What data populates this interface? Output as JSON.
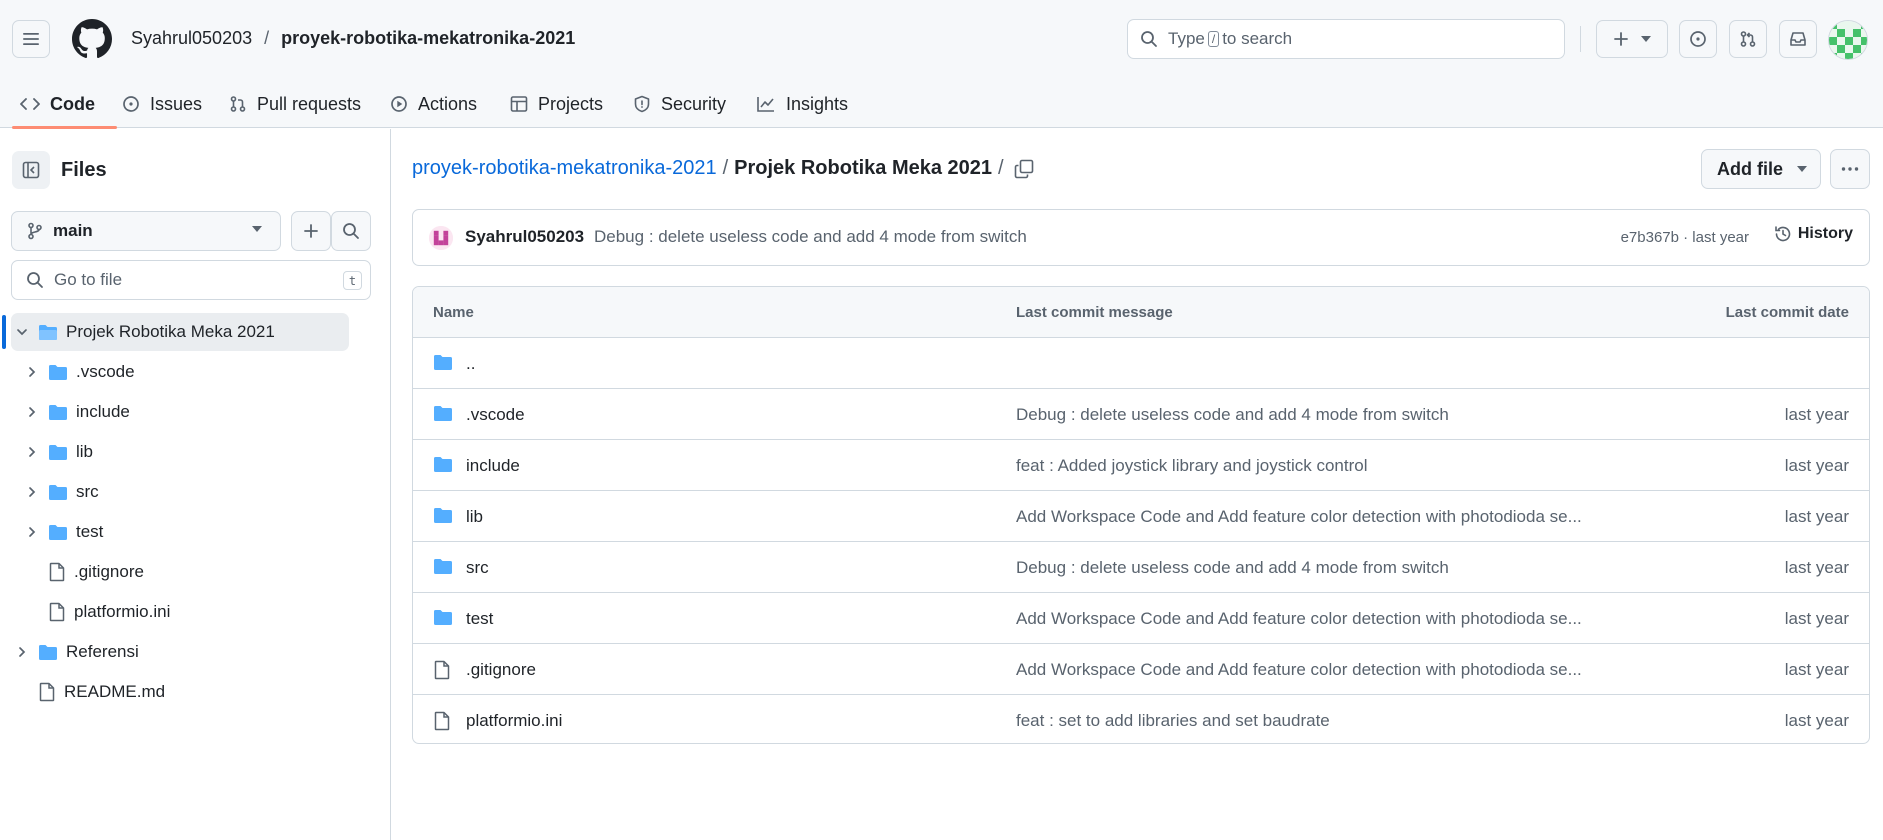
{
  "header": {
    "owner": "Syahrul050203",
    "separator": "/",
    "repo": "proyek-robotika-mekatronika-2021",
    "search_prefix": "Type",
    "search_key": "/",
    "search_suffix": "to search"
  },
  "tabs": [
    {
      "label": "Code",
      "icon": "code-icon",
      "active": true
    },
    {
      "label": "Issues",
      "icon": "issue-icon"
    },
    {
      "label": "Pull requests",
      "icon": "pull-request-icon"
    },
    {
      "label": "Actions",
      "icon": "play-icon"
    },
    {
      "label": "Projects",
      "icon": "table-icon"
    },
    {
      "label": "Security",
      "icon": "shield-icon"
    },
    {
      "label": "Insights",
      "icon": "graph-icon"
    }
  ],
  "sidebar": {
    "title": "Files",
    "branch": "main",
    "goto_placeholder": "Go to file",
    "goto_key": "t",
    "tree": [
      {
        "label": "Projek Robotika Meka 2021",
        "type": "folder",
        "expanded": true,
        "selected": true
      },
      {
        "label": ".vscode",
        "type": "folder"
      },
      {
        "label": "include",
        "type": "folder"
      },
      {
        "label": "lib",
        "type": "folder"
      },
      {
        "label": "src",
        "type": "folder"
      },
      {
        "label": "test",
        "type": "folder"
      },
      {
        "label": ".gitignore",
        "type": "file"
      },
      {
        "label": "platformio.ini",
        "type": "file"
      },
      {
        "label": "Referensi",
        "type": "folder"
      },
      {
        "label": "README.md",
        "type": "file"
      }
    ]
  },
  "main": {
    "path_repo": "proyek-robotika-mekatronika-2021",
    "path_sep": "/",
    "path_current": "Projek Robotika Meka 2021",
    "path_trailing": "/",
    "add_file_label": "Add file",
    "commit": {
      "author": "Syahrul050203",
      "message": "Debug : delete useless code and add 4 mode from switch",
      "meta": "e7b367b · last year",
      "history_label": "History"
    },
    "table": {
      "headers": {
        "name": "Name",
        "message": "Last commit message",
        "date": "Last commit date"
      },
      "rows": [
        {
          "name": "..",
          "type": "folder",
          "message": "",
          "date": ""
        },
        {
          "name": ".vscode",
          "type": "folder",
          "message": "Debug : delete useless code and add 4 mode from switch",
          "date": "last year"
        },
        {
          "name": "include",
          "type": "folder",
          "message": "feat : Added joystick library and joystick control",
          "date": "last year"
        },
        {
          "name": "lib",
          "type": "folder",
          "message": "Add Workspace Code and Add feature color detection with photodioda se...",
          "date": "last year"
        },
        {
          "name": "src",
          "type": "folder",
          "message": "Debug : delete useless code and add 4 mode from switch",
          "date": "last year"
        },
        {
          "name": "test",
          "type": "folder",
          "message": "Add Workspace Code and Add feature color detection with photodioda se...",
          "date": "last year"
        },
        {
          "name": ".gitignore",
          "type": "file",
          "message": "Add Workspace Code and Add feature color detection with photodioda se...",
          "date": "last year"
        },
        {
          "name": "platformio.ini",
          "type": "file",
          "message": "feat : set to add libraries and set baudrate",
          "date": "last year"
        }
      ]
    }
  },
  "colors": {
    "accent": "#0969da",
    "folder": "#54aeff",
    "tab_underline": "#fd8c73",
    "border": "#d1d9e0"
  }
}
